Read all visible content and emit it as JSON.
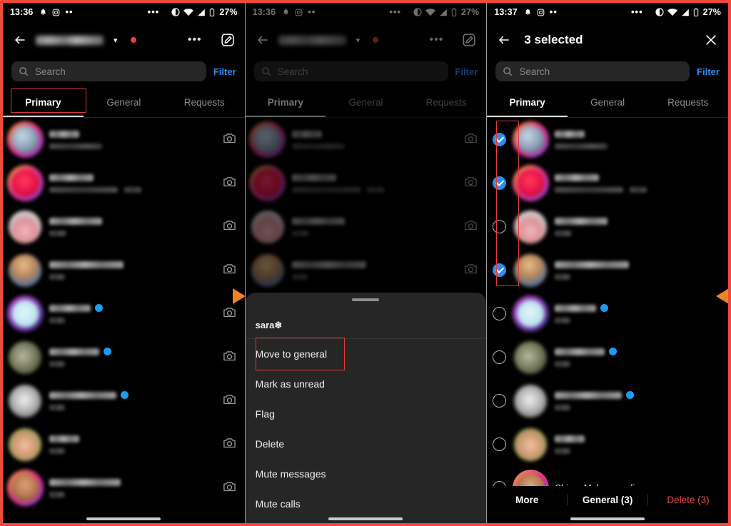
{
  "status_bar": {
    "time_1": "13:36",
    "time_2": "13:36",
    "time_3": "13:37",
    "battery": "27%",
    "left_icons": [
      "bell-icon",
      "instagram-icon",
      "more-dots-icon"
    ],
    "right_icons": [
      "more-dots-icon",
      "dnd-icon",
      "wifi-icon",
      "signal-icon",
      "battery-icon"
    ]
  },
  "colors": {
    "accent_blue": "#2b8ef0",
    "danger_red": "#ed4956",
    "annotation_red": "#e23b38",
    "arrow_orange": "#f08326",
    "sheet_bg": "#262626",
    "search_bg": "#262626",
    "page_bg": "#000000"
  },
  "panel1": {
    "header": {
      "back_icon": "arrow-left-icon",
      "username": "",
      "chevron": "⌄",
      "has_unread_dot": true,
      "more_icon": "more-horizontal-icon",
      "compose_icon": "compose-pencil-icon"
    },
    "search": {
      "placeholder": "Search",
      "icon": "search-icon",
      "filter_label": "Filter"
    },
    "tabs": [
      {
        "label": "Primary",
        "active": true,
        "annotated": true
      },
      {
        "label": "General",
        "active": false,
        "annotated": false
      },
      {
        "label": "Requests",
        "active": false,
        "annotated": false
      }
    ],
    "rows": [
      {
        "avatar": "av-1",
        "name_w": 42,
        "sub_w": 74,
        "sub2_w": 0,
        "verified": false,
        "sub_two": false,
        "camera": true
      },
      {
        "avatar": "av-2",
        "name_w": 62,
        "sub_w": 96,
        "sub2_w": 24,
        "verified": false,
        "sub_two": true,
        "camera": true
      },
      {
        "avatar": "av-3",
        "name_w": 74,
        "sub_w": 24,
        "sub2_w": 0,
        "verified": false,
        "sub_two": false,
        "camera": true
      },
      {
        "avatar": "av-4",
        "name_w": 104,
        "sub_w": 22,
        "sub2_w": 0,
        "verified": false,
        "sub_two": false,
        "camera": true
      },
      {
        "avatar": "av-5",
        "name_w": 58,
        "sub_w": 22,
        "sub2_w": 0,
        "verified": true,
        "sub_two": false,
        "camera": true
      },
      {
        "avatar": "av-6",
        "name_w": 70,
        "sub_w": 22,
        "sub2_w": 0,
        "verified": true,
        "sub_two": false,
        "camera": true
      },
      {
        "avatar": "av-7",
        "name_w": 94,
        "sub_w": 22,
        "sub2_w": 0,
        "verified": true,
        "sub_two": false,
        "camera": true
      },
      {
        "avatar": "av-8",
        "name_w": 42,
        "sub_w": 22,
        "sub2_w": 0,
        "verified": false,
        "sub_two": false,
        "camera": true
      },
      {
        "avatar": "av-9",
        "name_w": 100,
        "sub_w": 22,
        "sub2_w": 0,
        "verified": false,
        "sub_two": false,
        "camera": true
      }
    ]
  },
  "panel2": {
    "dimmed": true,
    "sheet": {
      "title": "sara❄",
      "items": [
        {
          "label": "Move to general",
          "annotated": true
        },
        {
          "label": "Mark as unread",
          "annotated": false
        },
        {
          "label": "Flag",
          "annotated": false
        },
        {
          "label": "Delete",
          "annotated": false
        },
        {
          "label": "Mute messages",
          "annotated": false
        },
        {
          "label": "Mute calls",
          "annotated": false
        }
      ]
    }
  },
  "panel3": {
    "header": {
      "back_icon": "arrow-left-icon",
      "title": "3 selected",
      "close_icon": "close-x-icon"
    },
    "search": {
      "placeholder": "Search",
      "icon": "search-icon",
      "filter_label": "Filter"
    },
    "tabs": [
      {
        "label": "Primary",
        "active": true
      },
      {
        "label": "General",
        "active": false
      },
      {
        "label": "Requests",
        "active": false
      }
    ],
    "selection_annotation": true,
    "rows": [
      {
        "avatar": "av-1",
        "checked": true,
        "name_w": 42,
        "sub_w": 74,
        "sub2_w": 0,
        "verified": false,
        "sub_two": false,
        "sharp_name": ""
      },
      {
        "avatar": "av-2",
        "checked": true,
        "name_w": 62,
        "sub_w": 96,
        "sub2_w": 24,
        "verified": false,
        "sub_two": true,
        "sharp_name": ""
      },
      {
        "avatar": "av-3",
        "checked": false,
        "name_w": 74,
        "sub_w": 24,
        "sub2_w": 0,
        "verified": false,
        "sub_two": false,
        "sharp_name": ""
      },
      {
        "avatar": "av-4",
        "checked": true,
        "name_w": 104,
        "sub_w": 22,
        "sub2_w": 0,
        "verified": false,
        "sub_two": false,
        "sharp_name": ""
      },
      {
        "avatar": "av-5",
        "checked": false,
        "name_w": 58,
        "sub_w": 22,
        "sub2_w": 0,
        "verified": true,
        "sub_two": false,
        "sharp_name": ""
      },
      {
        "avatar": "av-6",
        "checked": false,
        "name_w": 70,
        "sub_w": 22,
        "sub2_w": 0,
        "verified": true,
        "sub_two": false,
        "sharp_name": ""
      },
      {
        "avatar": "av-7",
        "checked": false,
        "name_w": 94,
        "sub_w": 22,
        "sub2_w": 0,
        "verified": true,
        "sub_two": false,
        "sharp_name": ""
      },
      {
        "avatar": "av-8",
        "checked": false,
        "name_w": 42,
        "sub_w": 22,
        "sub2_w": 0,
        "verified": false,
        "sub_two": false,
        "sharp_name": ""
      },
      {
        "avatar": "av-9",
        "checked": false,
        "name_w": 0,
        "sub_w": 0,
        "sub2_w": 0,
        "verified": false,
        "sub_two": false,
        "sharp_name": "Shima Mohammadi"
      }
    ],
    "actions": [
      {
        "label": "More",
        "style": "normal"
      },
      {
        "label": "General (3)",
        "style": "normal"
      },
      {
        "label": "Delete (3)",
        "style": "danger"
      }
    ]
  }
}
